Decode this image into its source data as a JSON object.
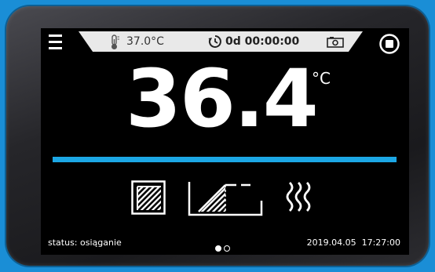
{
  "header": {
    "setpoint": "37.0°C",
    "timer": "0d 00:00:00"
  },
  "main": {
    "temperature": "36.4",
    "unit": "°C",
    "progress": 1.0
  },
  "modes": [
    {
      "icon": "chamber-icon"
    },
    {
      "icon": "ramp-icon"
    },
    {
      "icon": "heating-icon"
    }
  ],
  "footer": {
    "status": "status: osiąganie",
    "date": "2019.04.05",
    "time": "17:27:00",
    "pages": 2,
    "active_page": 1
  },
  "colors": {
    "accent": "#1ca7e5",
    "background": "#000000",
    "strip": "#e9e9e9"
  }
}
